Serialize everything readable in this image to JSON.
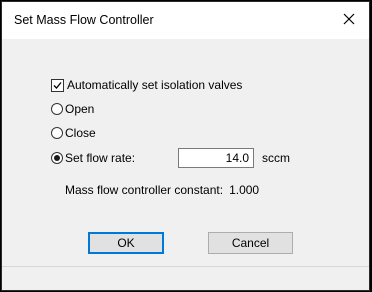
{
  "window": {
    "title": "Set Mass Flow Controller",
    "close_glyph": "close-icon"
  },
  "options": {
    "auto_isolation": {
      "label": "Automatically set isolation valves",
      "checked": true
    },
    "mode": {
      "selected": "set_flow_rate",
      "open_label": "Open",
      "close_label": "Close",
      "set_flow_rate_label": "Set flow rate:"
    }
  },
  "flow": {
    "value": "14.0",
    "unit": "sccm"
  },
  "constant": {
    "label": "Mass flow controller constant:",
    "value": "1.000"
  },
  "buttons": {
    "ok": "OK",
    "cancel": "Cancel"
  },
  "colors": {
    "default_button_border": "#0078d7",
    "dialog_background": "#f0f0f0"
  }
}
